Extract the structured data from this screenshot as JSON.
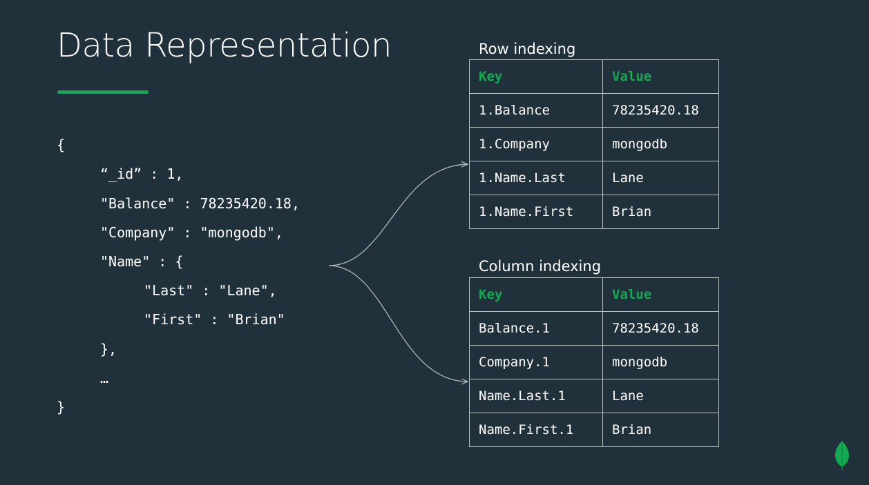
{
  "title": "Data Representation",
  "colors": {
    "background": "#21313c",
    "accent": "#13aa52",
    "text": "#ffffff",
    "border": "#b8c4c2"
  },
  "code_lines": [
    "{",
    "“_id” : 1,",
    "\"Balance\" : 78235420.18,",
    "\"Company\" : \"mongodb\",",
    "\"Name\" : {",
    "\"Last\" : \"Lane\",",
    "\"First\" : \"Brian\"",
    "},",
    "…",
    "}"
  ],
  "row_indexing": {
    "label": "Row indexing",
    "headers": [
      "Key",
      "Value"
    ],
    "rows": [
      [
        "1.Balance",
        "78235420.18"
      ],
      [
        "1.Company",
        "mongodb"
      ],
      [
        "1.Name.Last",
        "Lane"
      ],
      [
        "1.Name.First",
        "Brian"
      ]
    ]
  },
  "column_indexing": {
    "label": "Column indexing",
    "headers": [
      "Key",
      "Value"
    ],
    "rows": [
      [
        "Balance.1",
        "78235420.18"
      ],
      [
        "Company.1",
        "mongodb"
      ],
      [
        "Name.Last.1",
        "Lane"
      ],
      [
        "Name.First.1",
        "Brian"
      ]
    ]
  },
  "logo_icon": "mongodb-leaf-icon"
}
